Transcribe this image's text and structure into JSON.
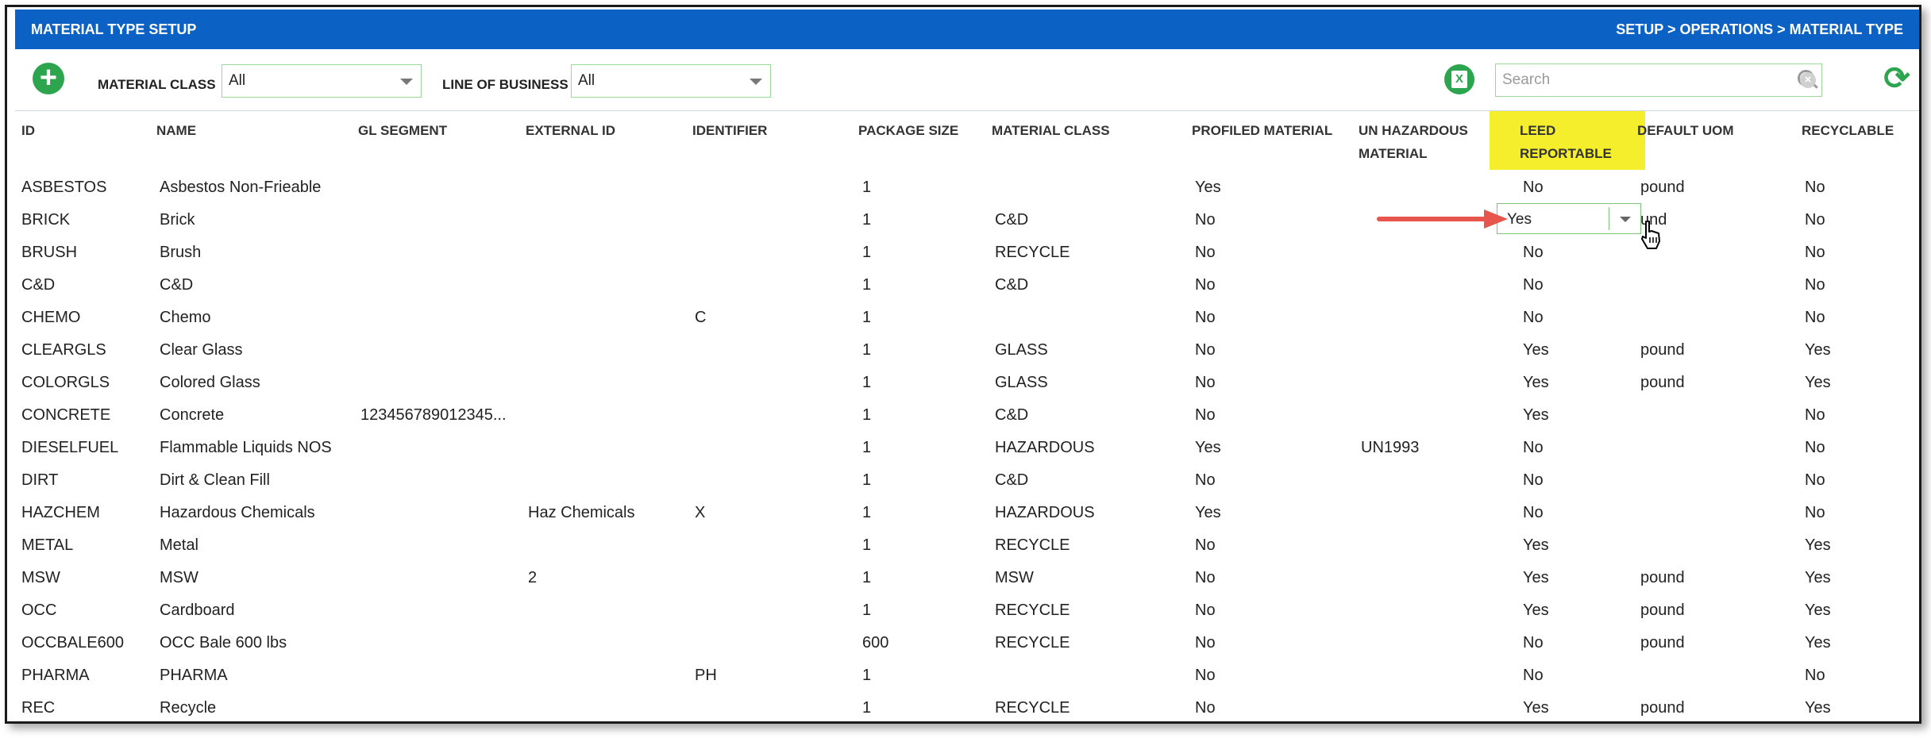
{
  "header": {
    "title": "MATERIAL TYPE SETUP",
    "breadcrumb": "SETUP > OPERATIONS > MATERIAL TYPE"
  },
  "toolbar": {
    "material_class_label": "MATERIAL CLASS",
    "material_class_value": "All",
    "line_of_business_label": "LINE OF BUSINESS",
    "line_of_business_value": "All",
    "search_placeholder": "Search",
    "icons": [
      "add-icon",
      "excel-export-icon",
      "search-icon",
      "clear-icon",
      "refresh-icon"
    ]
  },
  "colors": {
    "header_blue": "#0b62c4",
    "action_green": "#2da44e",
    "highlight_yellow": "#f5ee2c",
    "arrow_red": "#e8554d"
  },
  "columns": {
    "id": "ID",
    "name": "NAME",
    "gl_segment": "GL SEGMENT",
    "external_id": "EXTERNAL ID",
    "identifier": "IDENTIFIER",
    "package_size": "PACKAGE SIZE",
    "material_class": "MATERIAL CLASS",
    "profiled_line1": "PROFILED MATERIAL",
    "un_hazardous_line1": "UN HAZARDOUS",
    "un_hazardous_line2": "MATERIAL",
    "leed_line1": "LEED",
    "leed_line2": "REPORTABLE",
    "default_uom": "DEFAULT UOM",
    "recyclable": "RECYCLABLE"
  },
  "rows": [
    {
      "id": "ASBESTOS",
      "name": "Asbestos Non-Frieable",
      "gl": "",
      "ext": "",
      "ident": "",
      "pkg": "1",
      "cls": "",
      "prof": "Yes",
      "un": "",
      "leed": "No",
      "uom": "pound",
      "recy": "No"
    },
    {
      "id": "BRICK",
      "name": "Brick",
      "gl": "",
      "ext": "",
      "ident": "",
      "pkg": "1",
      "cls": "C&D",
      "prof": "No",
      "un": "",
      "leed": "Yes",
      "uom": "und",
      "recy": "No"
    },
    {
      "id": "BRUSH",
      "name": "Brush",
      "gl": "",
      "ext": "",
      "ident": "",
      "pkg": "1",
      "cls": "RECYCLE",
      "prof": "No",
      "un": "",
      "leed": "No",
      "uom": "",
      "recy": "No"
    },
    {
      "id": "C&D",
      "name": "C&D",
      "gl": "",
      "ext": "",
      "ident": "",
      "pkg": "1",
      "cls": "C&D",
      "prof": "No",
      "un": "",
      "leed": "No",
      "uom": "",
      "recy": "No"
    },
    {
      "id": "CHEMO",
      "name": "Chemo",
      "gl": "",
      "ext": "",
      "ident": "C",
      "pkg": "1",
      "cls": "",
      "prof": "No",
      "un": "",
      "leed": "No",
      "uom": "",
      "recy": "No"
    },
    {
      "id": "CLEARGLS",
      "name": "Clear Glass",
      "gl": "",
      "ext": "",
      "ident": "",
      "pkg": "1",
      "cls": "GLASS",
      "prof": "No",
      "un": "",
      "leed": "Yes",
      "uom": "pound",
      "recy": "Yes"
    },
    {
      "id": "COLORGLS",
      "name": "Colored Glass",
      "gl": "",
      "ext": "",
      "ident": "",
      "pkg": "1",
      "cls": "GLASS",
      "prof": "No",
      "un": "",
      "leed": "Yes",
      "uom": "pound",
      "recy": "Yes"
    },
    {
      "id": "CONCRETE",
      "name": "Concrete",
      "gl": "123456789012345...",
      "ext": "",
      "ident": "",
      "pkg": "1",
      "cls": "C&D",
      "prof": "No",
      "un": "",
      "leed": "Yes",
      "uom": "",
      "recy": "No"
    },
    {
      "id": "DIESELFUEL",
      "name": "Flammable Liquids NOS",
      "gl": "",
      "ext": "",
      "ident": "",
      "pkg": "1",
      "cls": "HAZARDOUS",
      "prof": "Yes",
      "un": "UN1993",
      "leed": "No",
      "uom": "",
      "recy": "No"
    },
    {
      "id": "DIRT",
      "name": "Dirt & Clean Fill",
      "gl": "",
      "ext": "",
      "ident": "",
      "pkg": "1",
      "cls": "C&D",
      "prof": "No",
      "un": "",
      "leed": "No",
      "uom": "",
      "recy": "No"
    },
    {
      "id": "HAZCHEM",
      "name": "Hazardous Chemicals",
      "gl": "",
      "ext": "Haz Chemicals",
      "ident": "X",
      "pkg": "1",
      "cls": "HAZARDOUS",
      "prof": "Yes",
      "un": "",
      "leed": "No",
      "uom": "",
      "recy": "No"
    },
    {
      "id": "METAL",
      "name": "Metal",
      "gl": "",
      "ext": "",
      "ident": "",
      "pkg": "1",
      "cls": "RECYCLE",
      "prof": "No",
      "un": "",
      "leed": "Yes",
      "uom": "",
      "recy": "Yes"
    },
    {
      "id": "MSW",
      "name": "MSW",
      "gl": "",
      "ext": "2",
      "ident": "",
      "pkg": "1",
      "cls": "MSW",
      "prof": "No",
      "un": "",
      "leed": "Yes",
      "uom": "pound",
      "recy": "Yes"
    },
    {
      "id": "OCC",
      "name": "Cardboard",
      "gl": "",
      "ext": "",
      "ident": "",
      "pkg": "1",
      "cls": "RECYCLE",
      "prof": "No",
      "un": "",
      "leed": "Yes",
      "uom": "pound",
      "recy": "Yes"
    },
    {
      "id": "OCCBALE600",
      "name": "OCC Bale 600 lbs",
      "gl": "",
      "ext": "",
      "ident": "",
      "pkg": "600",
      "cls": "RECYCLE",
      "prof": "No",
      "un": "",
      "leed": "No",
      "uom": "pound",
      "recy": "Yes"
    },
    {
      "id": "PHARMA",
      "name": "PHARMA",
      "gl": "",
      "ext": "",
      "ident": "PH",
      "pkg": "1",
      "cls": "",
      "prof": "No",
      "un": "",
      "leed": "No",
      "uom": "",
      "recy": "No"
    },
    {
      "id": "REC",
      "name": "Recycle",
      "gl": "",
      "ext": "",
      "ident": "",
      "pkg": "1",
      "cls": "RECYCLE",
      "prof": "No",
      "un": "",
      "leed": "Yes",
      "uom": "pound",
      "recy": "Yes"
    }
  ]
}
